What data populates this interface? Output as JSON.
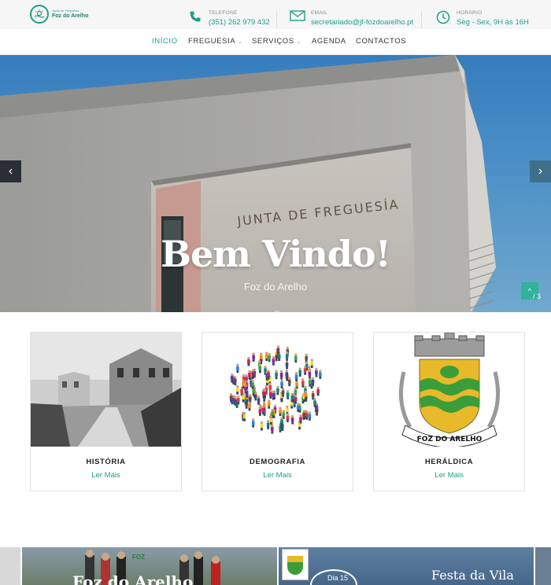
{
  "header": {
    "logo_small": "Junta de Freguesia",
    "logo_name": "Foz do Arelho",
    "contacts": [
      {
        "label": "TELEFONE",
        "value": "(351) 262 979 432",
        "icon": "phone-icon"
      },
      {
        "label": "EMAIL",
        "value": "secretariado@jf-fozdoarelho.pt",
        "icon": "envelope-icon"
      },
      {
        "label": "HORÁRIO",
        "value": "Seg - Sex, 9H às 16H",
        "icon": "clock-icon"
      }
    ]
  },
  "nav": {
    "items": [
      {
        "label": "INÍCIO",
        "active": true
      },
      {
        "label": "FREGUESIA",
        "dropdown": true
      },
      {
        "label": "SERVIÇOS",
        "dropdown": true
      },
      {
        "label": "AGENDA"
      },
      {
        "label": "CONTACTOS"
      }
    ],
    "caret": "⌄"
  },
  "hero": {
    "title": "Bem Vindo!",
    "subtitle": "Foz do Arelho",
    "building_sign": "JUNTA DE FREGUESÍA",
    "slide_counter": "/ 3",
    "prev_icon": "‹",
    "next_icon": "›",
    "to_top_icon": "^"
  },
  "cards": [
    {
      "title": "HISTÓRIA",
      "link": "Ler Mais"
    },
    {
      "title": "DEMOGRAFIA",
      "link": "Ler Mais"
    },
    {
      "title": "HERÁLDICA",
      "link": "Ler Mais",
      "crest_text": "FOZ DO ARELHO"
    }
  ],
  "strip": {
    "tile1_text": "Foz do Arelho",
    "tile1_logo": "FOZ",
    "tile2_text": "Festa da Vila",
    "tile2_badge": "Dia 15"
  },
  "colors": {
    "accent": "#1e9e8a",
    "hero_sky": "#4a96d4",
    "to_top": "#2fb39b"
  }
}
